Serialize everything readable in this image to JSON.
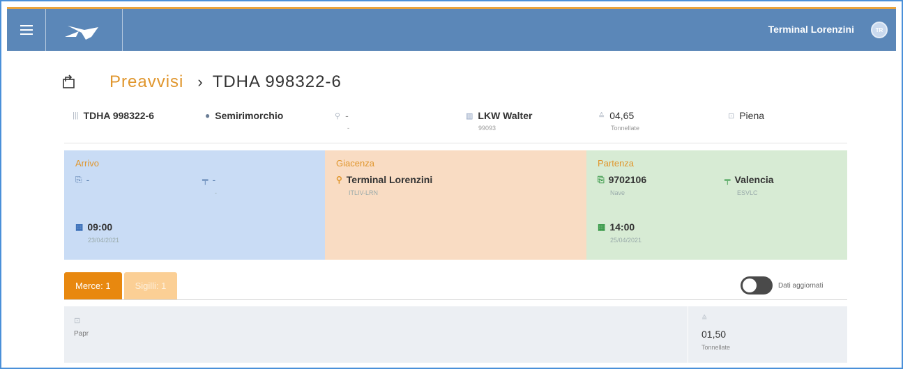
{
  "header": {
    "title": "Terminal Lorenzini",
    "avatar_initials": "TR",
    "bar_color": "#5b87b8",
    "accent_color": "#e8a33d"
  },
  "breadcrumb": {
    "parent": "Preavvisi",
    "separator": "›",
    "current": "TDHA 998322-6"
  },
  "info": {
    "container": {
      "icon": "barcode-icon",
      "value": "TDHA 998322-6"
    },
    "type": {
      "icon": "info-circle-icon",
      "value": "Semirimorchio"
    },
    "seal": {
      "icon": "key-icon",
      "value": "-",
      "sub": "-"
    },
    "carrier": {
      "icon": "company-icon",
      "value": "LKW Walter",
      "sub": "99093"
    },
    "weight": {
      "icon": "weight-icon",
      "value": "04,65",
      "sub": "Tonnellate"
    },
    "status": {
      "icon": "box-icon",
      "value": "Piena"
    }
  },
  "arrivo": {
    "label": "Arrivo",
    "vessel": "-",
    "place": "-",
    "place_sub": "-",
    "time": "09:00",
    "date": "23/04/2021"
  },
  "giacenza": {
    "label": "Giacenza",
    "terminal": "Terminal Lorenzini",
    "code": "ITLIV-LRN"
  },
  "partenza": {
    "label": "Partenza",
    "voyage": "9702106",
    "voyage_sub": "Nave",
    "destination": "Valencia",
    "destination_code": "ESVLC",
    "time": "14:00",
    "date": "25/04/2021"
  },
  "tabs": [
    {
      "label": "Merce: 1",
      "active": true
    },
    {
      "label": "Sigilli: 1",
      "active": false
    }
  ],
  "toggle": {
    "label": "Dati aggiornati",
    "on": false
  },
  "merce": {
    "name": "Papr",
    "weight": "01,50",
    "unit": "Tonnellate"
  },
  "colors": {
    "arrivo_bg": "#c9dcf5",
    "giacenza_bg": "#f9dcc3",
    "partenza_bg": "#d7ebd4",
    "tab_active": "#e8880f",
    "tab_inactive": "#fbcf95",
    "label_orange": "#e0962d"
  }
}
